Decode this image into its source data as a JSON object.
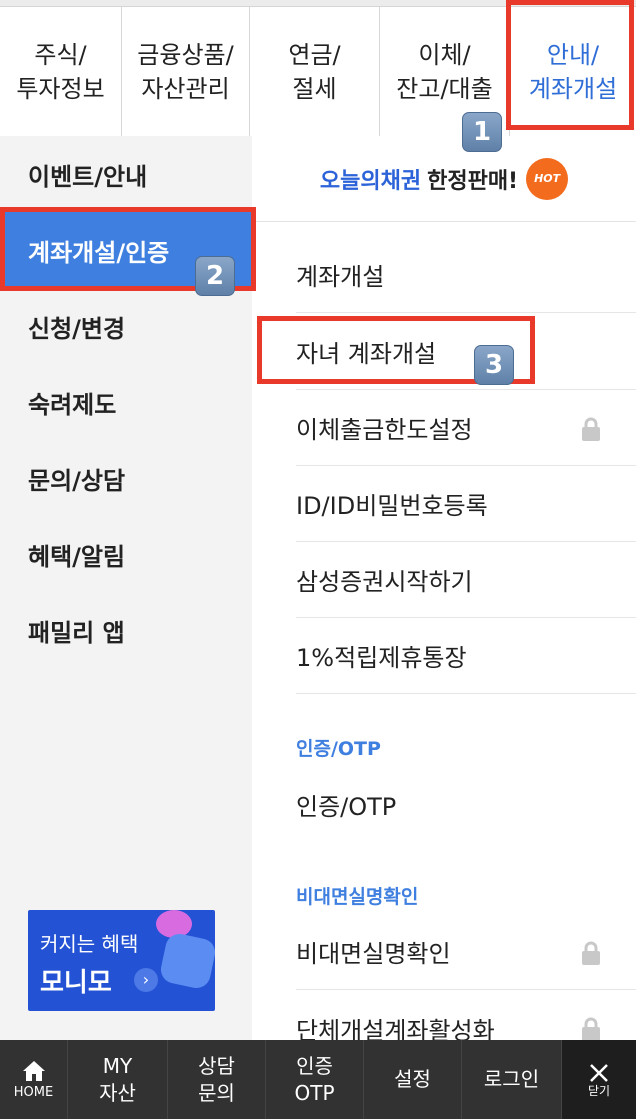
{
  "top_tabs": [
    {
      "line1": "주식/",
      "line2": "투자정보"
    },
    {
      "line1": "금융상품/",
      "line2": "자산관리"
    },
    {
      "line1": "연금/",
      "line2": "절세"
    },
    {
      "line1": "이체/",
      "line2": "잔고/대출"
    },
    {
      "line1": "안내/",
      "line2": "계좌개설"
    }
  ],
  "left_menu": [
    "이벤트/안내",
    "계좌개설/인증",
    "신청/변경",
    "숙려제도",
    "문의/상담",
    "혜택/알림",
    "패밀리 앱"
  ],
  "banner": {
    "brand": "오늘의채권",
    "text": "한정판매!",
    "badge": "HOT"
  },
  "account_items": [
    "계좌개설",
    "자녀 계좌개설",
    "이체출금한도설정",
    "ID/ID비밀번호등록",
    "삼성증권시작하기",
    "1%적립제휴통장"
  ],
  "cert_section": {
    "title": "인증/OTP",
    "items": [
      "인증/OTP"
    ]
  },
  "verify_section": {
    "title": "비대면실명확인",
    "items": [
      "비대면실명확인",
      "단체개설계좌활성화"
    ]
  },
  "promo": {
    "line1": "커지는 혜택",
    "line2": "모니모",
    "arrow": "›"
  },
  "annotations": [
    "1",
    "2",
    "3"
  ],
  "bottom_bar": {
    "home": "HOME",
    "my_line1": "MY",
    "my_line2": "자산",
    "consult_line1": "상담",
    "consult_line2": "문의",
    "otp_line1": "인증",
    "otp_line2": "OTP",
    "settings": "설정",
    "login": "로그인",
    "close": "닫기"
  },
  "colors": {
    "accent": "#3f7fe0",
    "highlight": "#e8392a",
    "bottom_bar": "#323232"
  },
  "icons": {
    "lock": "lock-icon",
    "home": "home-icon",
    "close": "close-icon"
  }
}
